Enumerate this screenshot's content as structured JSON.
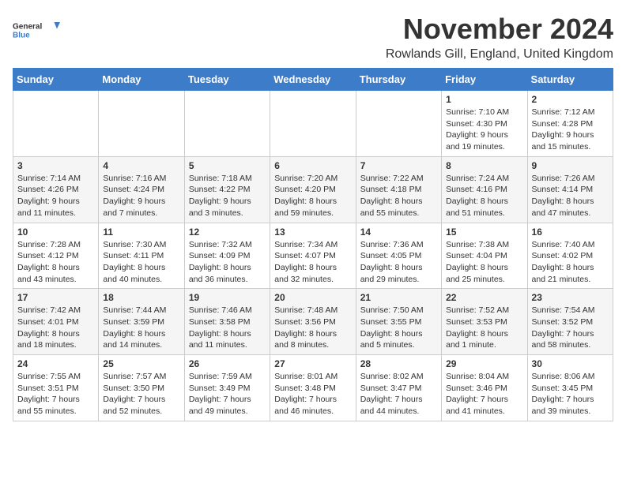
{
  "header": {
    "logo_line1": "General",
    "logo_line2": "Blue",
    "month": "November 2024",
    "location": "Rowlands Gill, England, United Kingdom"
  },
  "weekdays": [
    "Sunday",
    "Monday",
    "Tuesday",
    "Wednesday",
    "Thursday",
    "Friday",
    "Saturday"
  ],
  "weeks": [
    [
      {
        "day": "",
        "content": ""
      },
      {
        "day": "",
        "content": ""
      },
      {
        "day": "",
        "content": ""
      },
      {
        "day": "",
        "content": ""
      },
      {
        "day": "",
        "content": ""
      },
      {
        "day": "1",
        "content": "Sunrise: 7:10 AM\nSunset: 4:30 PM\nDaylight: 9 hours and 19 minutes."
      },
      {
        "day": "2",
        "content": "Sunrise: 7:12 AM\nSunset: 4:28 PM\nDaylight: 9 hours and 15 minutes."
      }
    ],
    [
      {
        "day": "3",
        "content": "Sunrise: 7:14 AM\nSunset: 4:26 PM\nDaylight: 9 hours and 11 minutes."
      },
      {
        "day": "4",
        "content": "Sunrise: 7:16 AM\nSunset: 4:24 PM\nDaylight: 9 hours and 7 minutes."
      },
      {
        "day": "5",
        "content": "Sunrise: 7:18 AM\nSunset: 4:22 PM\nDaylight: 9 hours and 3 minutes."
      },
      {
        "day": "6",
        "content": "Sunrise: 7:20 AM\nSunset: 4:20 PM\nDaylight: 8 hours and 59 minutes."
      },
      {
        "day": "7",
        "content": "Sunrise: 7:22 AM\nSunset: 4:18 PM\nDaylight: 8 hours and 55 minutes."
      },
      {
        "day": "8",
        "content": "Sunrise: 7:24 AM\nSunset: 4:16 PM\nDaylight: 8 hours and 51 minutes."
      },
      {
        "day": "9",
        "content": "Sunrise: 7:26 AM\nSunset: 4:14 PM\nDaylight: 8 hours and 47 minutes."
      }
    ],
    [
      {
        "day": "10",
        "content": "Sunrise: 7:28 AM\nSunset: 4:12 PM\nDaylight: 8 hours and 43 minutes."
      },
      {
        "day": "11",
        "content": "Sunrise: 7:30 AM\nSunset: 4:11 PM\nDaylight: 8 hours and 40 minutes."
      },
      {
        "day": "12",
        "content": "Sunrise: 7:32 AM\nSunset: 4:09 PM\nDaylight: 8 hours and 36 minutes."
      },
      {
        "day": "13",
        "content": "Sunrise: 7:34 AM\nSunset: 4:07 PM\nDaylight: 8 hours and 32 minutes."
      },
      {
        "day": "14",
        "content": "Sunrise: 7:36 AM\nSunset: 4:05 PM\nDaylight: 8 hours and 29 minutes."
      },
      {
        "day": "15",
        "content": "Sunrise: 7:38 AM\nSunset: 4:04 PM\nDaylight: 8 hours and 25 minutes."
      },
      {
        "day": "16",
        "content": "Sunrise: 7:40 AM\nSunset: 4:02 PM\nDaylight: 8 hours and 21 minutes."
      }
    ],
    [
      {
        "day": "17",
        "content": "Sunrise: 7:42 AM\nSunset: 4:01 PM\nDaylight: 8 hours and 18 minutes."
      },
      {
        "day": "18",
        "content": "Sunrise: 7:44 AM\nSunset: 3:59 PM\nDaylight: 8 hours and 14 minutes."
      },
      {
        "day": "19",
        "content": "Sunrise: 7:46 AM\nSunset: 3:58 PM\nDaylight: 8 hours and 11 minutes."
      },
      {
        "day": "20",
        "content": "Sunrise: 7:48 AM\nSunset: 3:56 PM\nDaylight: 8 hours and 8 minutes."
      },
      {
        "day": "21",
        "content": "Sunrise: 7:50 AM\nSunset: 3:55 PM\nDaylight: 8 hours and 5 minutes."
      },
      {
        "day": "22",
        "content": "Sunrise: 7:52 AM\nSunset: 3:53 PM\nDaylight: 8 hours and 1 minute."
      },
      {
        "day": "23",
        "content": "Sunrise: 7:54 AM\nSunset: 3:52 PM\nDaylight: 7 hours and 58 minutes."
      }
    ],
    [
      {
        "day": "24",
        "content": "Sunrise: 7:55 AM\nSunset: 3:51 PM\nDaylight: 7 hours and 55 minutes."
      },
      {
        "day": "25",
        "content": "Sunrise: 7:57 AM\nSunset: 3:50 PM\nDaylight: 7 hours and 52 minutes."
      },
      {
        "day": "26",
        "content": "Sunrise: 7:59 AM\nSunset: 3:49 PM\nDaylight: 7 hours and 49 minutes."
      },
      {
        "day": "27",
        "content": "Sunrise: 8:01 AM\nSunset: 3:48 PM\nDaylight: 7 hours and 46 minutes."
      },
      {
        "day": "28",
        "content": "Sunrise: 8:02 AM\nSunset: 3:47 PM\nDaylight: 7 hours and 44 minutes."
      },
      {
        "day": "29",
        "content": "Sunrise: 8:04 AM\nSunset: 3:46 PM\nDaylight: 7 hours and 41 minutes."
      },
      {
        "day": "30",
        "content": "Sunrise: 8:06 AM\nSunset: 3:45 PM\nDaylight: 7 hours and 39 minutes."
      }
    ]
  ]
}
